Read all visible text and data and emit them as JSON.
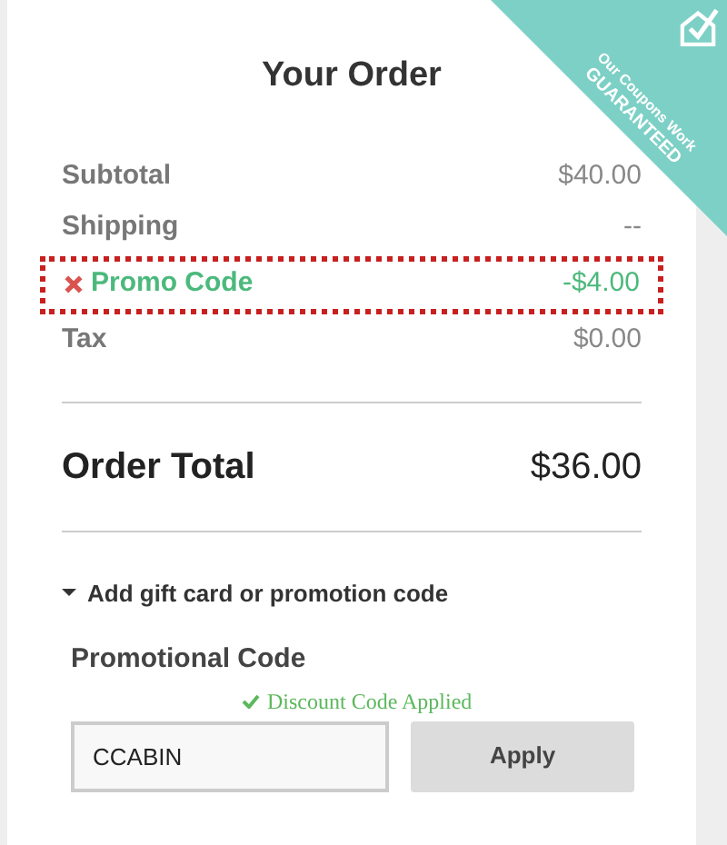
{
  "ribbon": {
    "line_1": "Our Coupons Work",
    "line_2": "GUARANTEED"
  },
  "title": "Your Order",
  "rows": [
    {
      "kind": "plain",
      "label": "Subtotal",
      "value": "$40.00"
    },
    {
      "kind": "plain",
      "label": "Shipping",
      "value": "--"
    },
    {
      "kind": "promo",
      "label": "Promo Code",
      "value": "-$4.00",
      "highlighted": true
    },
    {
      "kind": "plain",
      "label": "Tax",
      "value": "$0.00"
    }
  ],
  "total": {
    "label": "Order Total",
    "value": "$36.00"
  },
  "promo_toggle": {
    "label": "Add gift card or promotion code",
    "expanded": true
  },
  "promo_form": {
    "label": "Promotional Code",
    "status": "Discount Code Applied",
    "value": "CCABIN",
    "button": "Apply"
  }
}
